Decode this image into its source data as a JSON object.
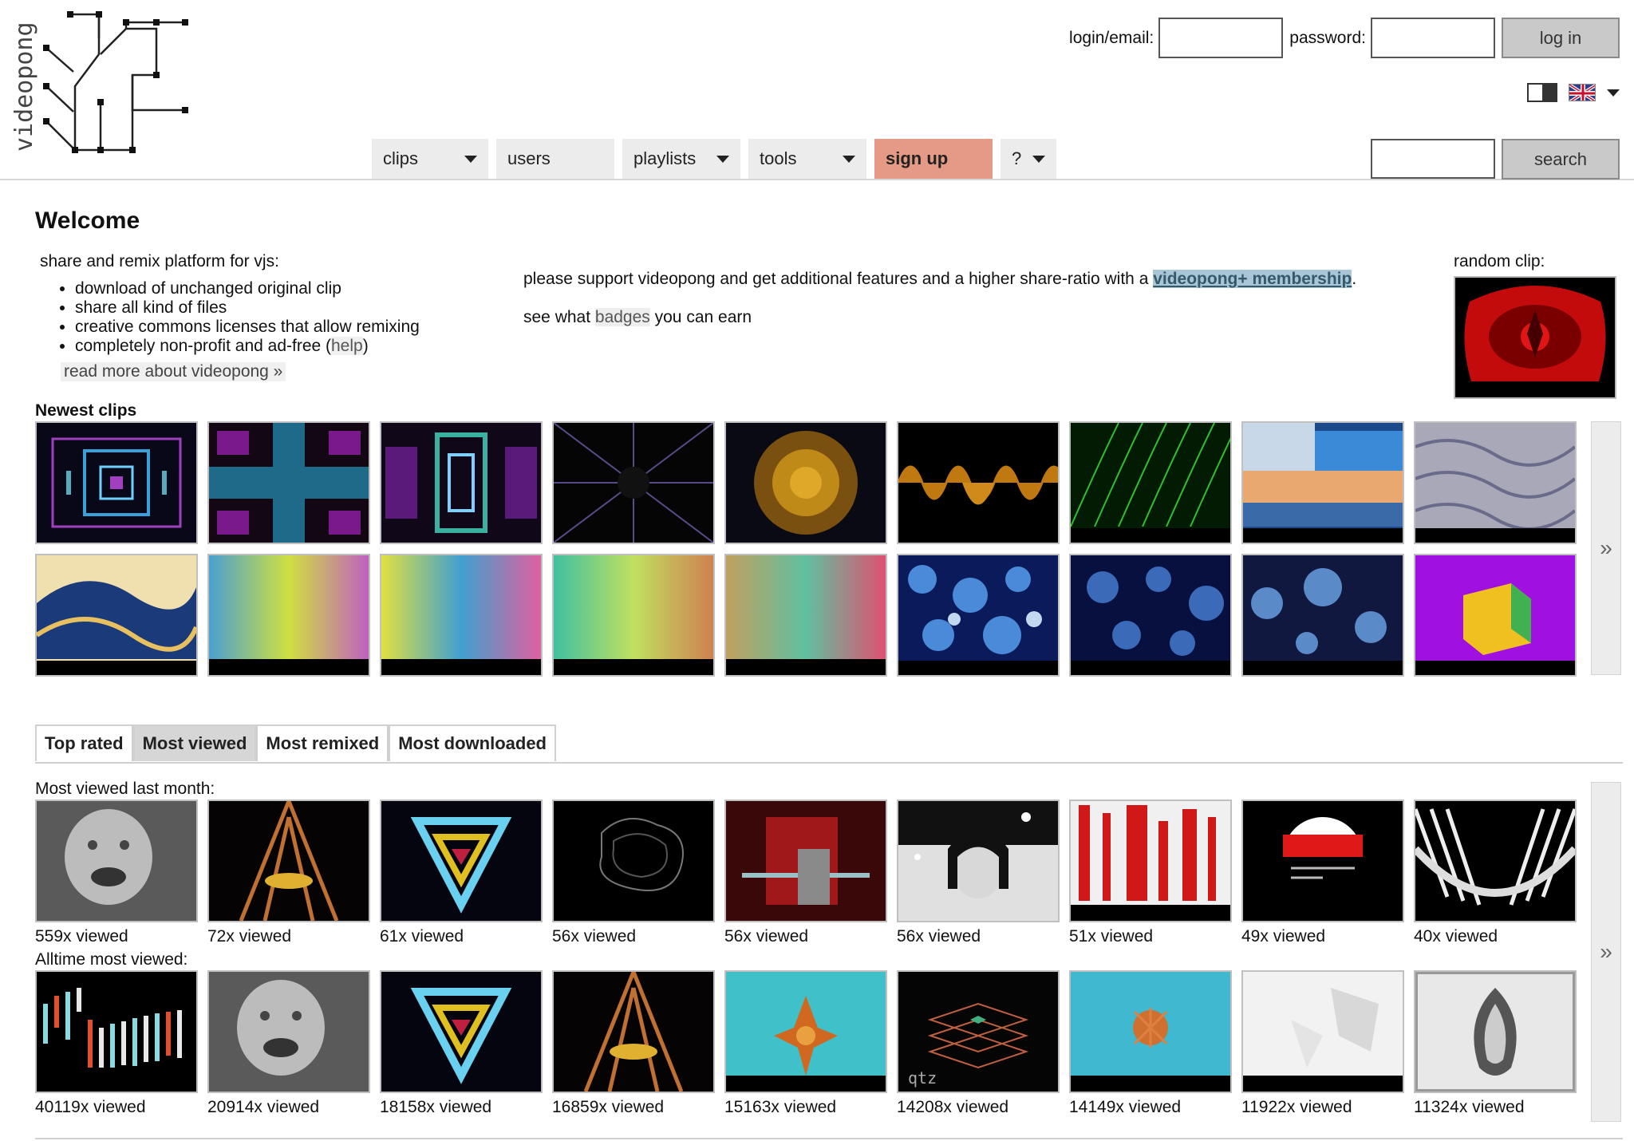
{
  "logo": {
    "text": "videopong"
  },
  "login": {
    "email_label": "login/email:",
    "password_label": "password:",
    "login_button": "log in"
  },
  "nav": {
    "clips": "clips",
    "users": "users",
    "playlists": "playlists",
    "tools": "tools",
    "signup": "sign up",
    "help": "?"
  },
  "search": {
    "button": "search"
  },
  "welcome": {
    "title": "Welcome",
    "tagline": "share and remix platform for vjs:",
    "features": [
      "download of unchanged original clip",
      "share all kind of files",
      "creative commons licenses that allow remixing",
      "completely non-profit and ad-free ("
    ],
    "help_link": "help",
    "help_close": ")",
    "read_more": "read more about videopong »"
  },
  "support": {
    "line1_prefix": "please support videopong and get additional features and a higher share-ratio with a ",
    "membership_link": "videopong+ membership",
    "line1_suffix": ".",
    "line2_prefix": "see what ",
    "badges_link": "badges",
    "line2_suffix": " you can earn"
  },
  "random_clip": {
    "label": "random clip:"
  },
  "newest": {
    "label": "Newest clips",
    "more": "»"
  },
  "tabs": [
    "Top rated",
    "Most viewed",
    "Most remixed",
    "Most downloaded"
  ],
  "active_tab": "Most viewed",
  "most_viewed_month": {
    "label": "Most viewed last month:",
    "counts": [
      "559x viewed",
      "72x viewed",
      "61x viewed",
      "56x viewed",
      "56x viewed",
      "56x viewed",
      "51x viewed",
      "49x viewed",
      "40x viewed"
    ]
  },
  "alltime": {
    "label": "Alltime most viewed:",
    "counts": [
      "40119x viewed",
      "20914x viewed",
      "18158x viewed",
      "16859x viewed",
      "15163x viewed",
      "14208x viewed",
      "14149x viewed",
      "11922x viewed",
      "11324x viewed"
    ],
    "more": "»"
  },
  "colors": {
    "signup_bg": "#e59a86",
    "membership_highlight": "#a8c6d6",
    "active_tab_bg": "#d6d6d6"
  }
}
